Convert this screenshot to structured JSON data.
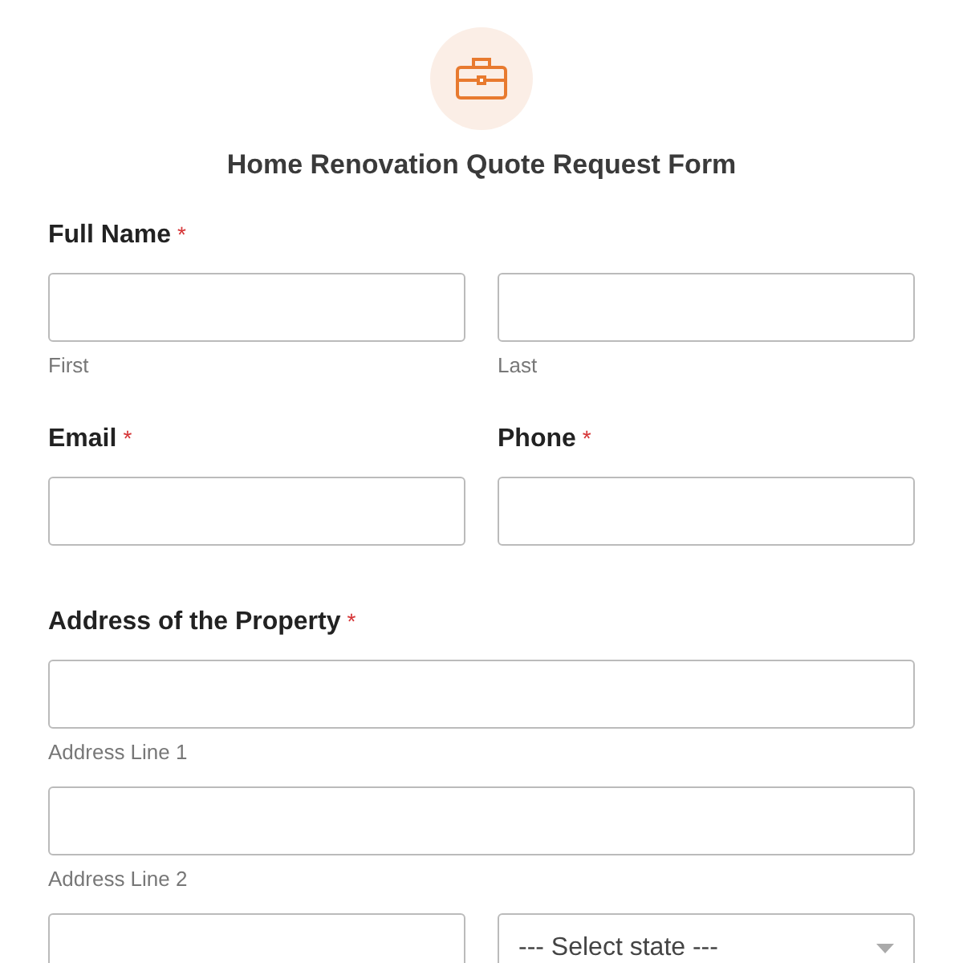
{
  "form": {
    "title": "Home Renovation Quote Request Form"
  },
  "sections": [
    {
      "fields": [
        {
          "label": "Full Name",
          "required_mark": "*",
          "rows": [
            [
              {
                "kind": "input",
                "sublabel": "First"
              },
              {
                "kind": "input",
                "sublabel": "Last"
              }
            ]
          ]
        }
      ]
    },
    {
      "fields": [
        {
          "label": "Email",
          "required_mark": "*",
          "rows": [
            [
              {
                "kind": "input"
              }
            ]
          ]
        },
        {
          "label": "Phone",
          "required_mark": "*",
          "rows": [
            [
              {
                "kind": "input"
              }
            ]
          ]
        }
      ]
    },
    {
      "fields": [
        {
          "label": "Address of the Property",
          "required_mark": "*",
          "rows": [
            [
              {
                "kind": "input",
                "sublabel": "Address Line 1"
              }
            ],
            [
              {
                "kind": "input",
                "sublabel": "Address Line 2"
              }
            ],
            [
              {
                "kind": "input"
              },
              {
                "kind": "select",
                "placeholder": "--- Select state ---"
              }
            ]
          ]
        }
      ]
    }
  ]
}
